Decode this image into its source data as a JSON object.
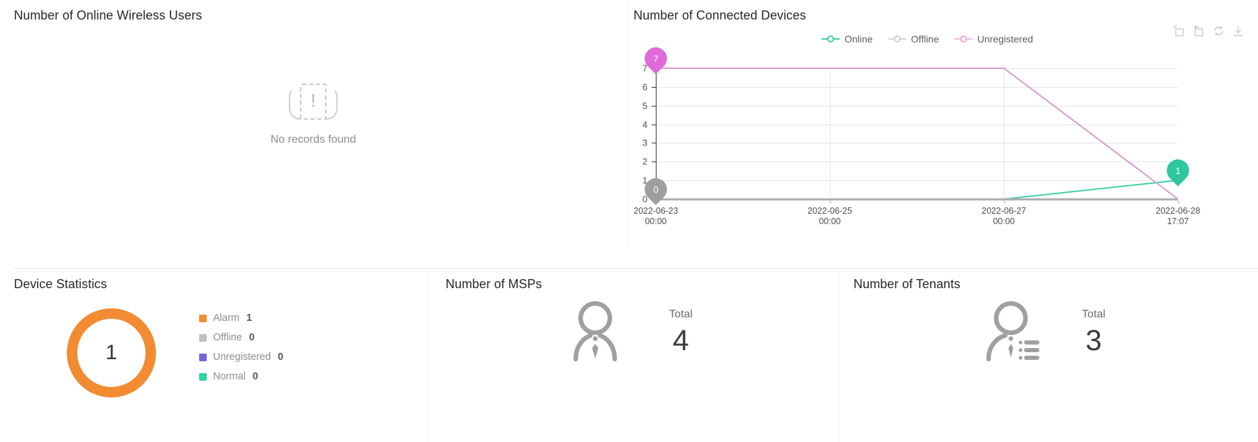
{
  "panels": {
    "wireless_users": {
      "title": "Number of Online Wireless Users",
      "empty_text": "No records found",
      "empty_icon": "no-records-icon"
    },
    "connected_devices": {
      "title": "Number of Connected Devices",
      "legend": [
        {
          "label": "Online",
          "color": "#3fd0ab"
        },
        {
          "label": "Offline",
          "color": "#cfcfcf"
        },
        {
          "label": "Unregistered",
          "color": "#e6a8dd"
        }
      ],
      "toolbox": [
        {
          "name": "data-zoom-icon",
          "title": "Data Zoom"
        },
        {
          "name": "zoom-reset-icon",
          "title": "Restore Zoom"
        },
        {
          "name": "refresh-icon",
          "title": "Refresh"
        },
        {
          "name": "download-icon",
          "title": "Save as Image"
        }
      ]
    },
    "device_statistics": {
      "title": "Device Statistics",
      "center_value": "1",
      "legend": [
        {
          "label": "Alarm",
          "value": "1",
          "color": "#f28b32"
        },
        {
          "label": "Offline",
          "value": "0",
          "color": "#bfbfbf"
        },
        {
          "label": "Unregistered",
          "value": "0",
          "color": "#7266e0"
        },
        {
          "label": "Normal",
          "value": "0",
          "color": "#2ed3a7"
        }
      ]
    },
    "msps": {
      "title": "Number of MSPs",
      "total_label": "Total",
      "total_value": "4",
      "icon": "msp-person-icon"
    },
    "tenants": {
      "title": "Number of Tenants",
      "total_label": "Total",
      "total_value": "3",
      "icon": "tenant-person-list-icon"
    }
  },
  "chart_data": {
    "type": "line",
    "title": "Number of Connected Devices",
    "xlabel": "",
    "ylabel": "",
    "ylim": [
      0,
      7
    ],
    "yticks": [
      "0",
      "1",
      "2",
      "3",
      "4",
      "5",
      "6",
      "7"
    ],
    "xticks": [
      {
        "date": "2022-06-23",
        "time": "00:00"
      },
      {
        "date": "2022-06-25",
        "time": "00:00"
      },
      {
        "date": "2022-06-27",
        "time": "00:00"
      },
      {
        "date": "2022-06-28",
        "time": "17:07"
      }
    ],
    "grid": true,
    "legend_position": "top-center",
    "series": [
      {
        "name": "Online",
        "color": "#3fd0ab",
        "values": [
          0,
          0,
          0,
          1
        ]
      },
      {
        "name": "Offline",
        "color": "#b0b0b0",
        "values": [
          0,
          0,
          0,
          0
        ]
      },
      {
        "name": "Unregistered",
        "color": "#d79ccf",
        "values": [
          7,
          7,
          7,
          0
        ]
      }
    ],
    "markers": [
      {
        "label": "7",
        "series": "Unregistered",
        "color": "#e06ad8",
        "x_pct": 0,
        "y_value": 7
      },
      {
        "label": "0",
        "series": "Offline",
        "color": "#9e9e9e",
        "x_pct": 0,
        "y_value": 0
      },
      {
        "label": "1",
        "series": "Online",
        "color": "#2ec7a0",
        "x_pct": 100,
        "y_value": 1
      }
    ]
  }
}
